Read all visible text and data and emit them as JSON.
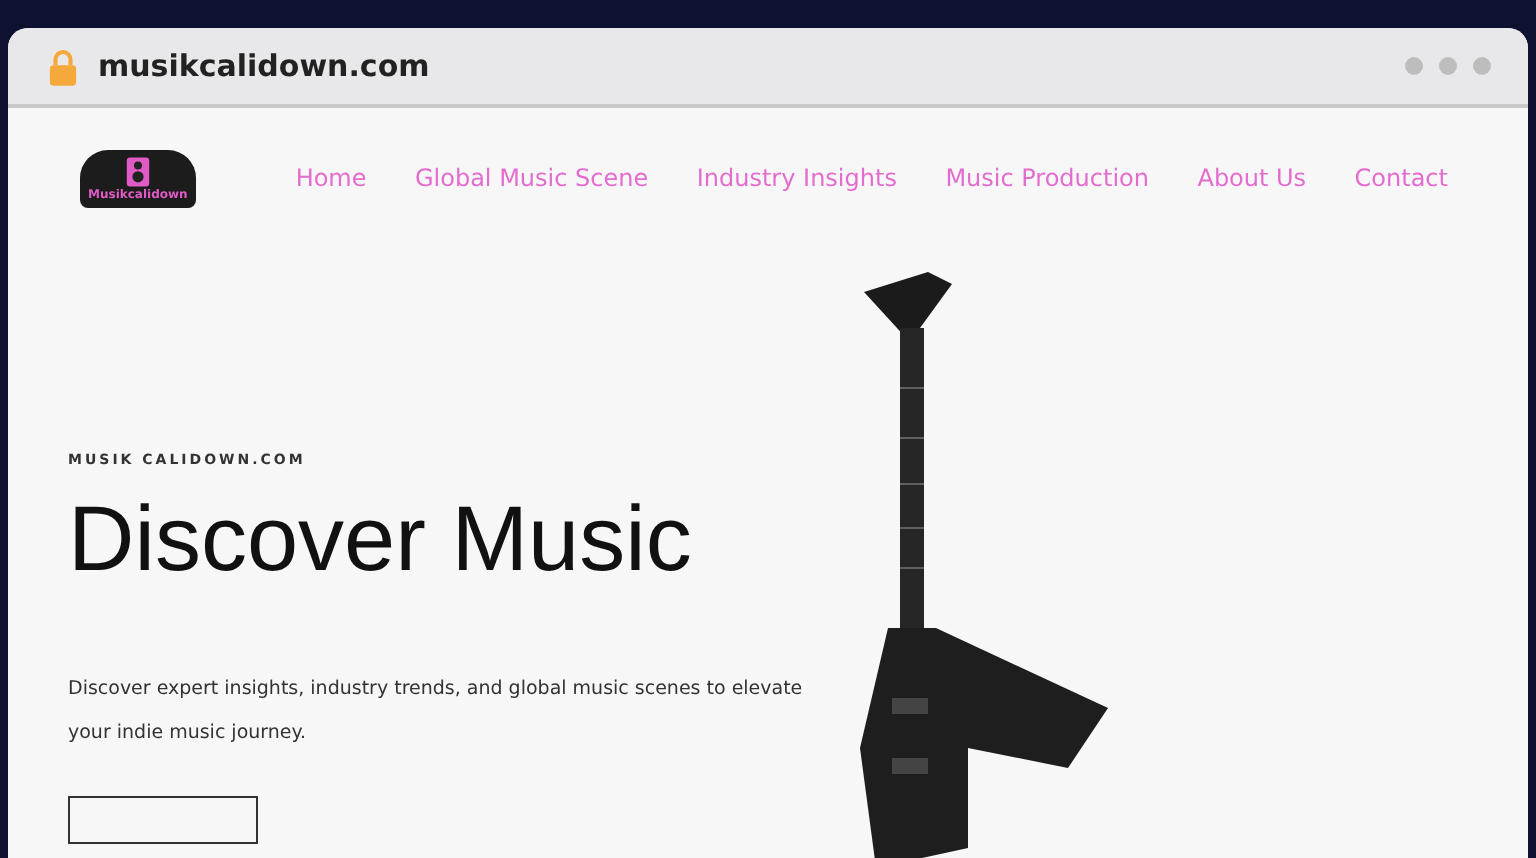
{
  "browser": {
    "url": "musikcalidown.com"
  },
  "site": {
    "logo_text": "Musikcalidown",
    "nav": [
      {
        "label": "Home"
      },
      {
        "label": "Global Music Scene"
      },
      {
        "label": "Industry Insights"
      },
      {
        "label": "Music Production"
      },
      {
        "label": "About Us"
      },
      {
        "label": "Contact"
      }
    ]
  },
  "hero": {
    "kicker": "MUSIK CALIDOWN.COM",
    "heading": "Discover Music",
    "text": "Discover expert insights, industry trends, and global music scenes to elevate your indie music journey."
  }
}
